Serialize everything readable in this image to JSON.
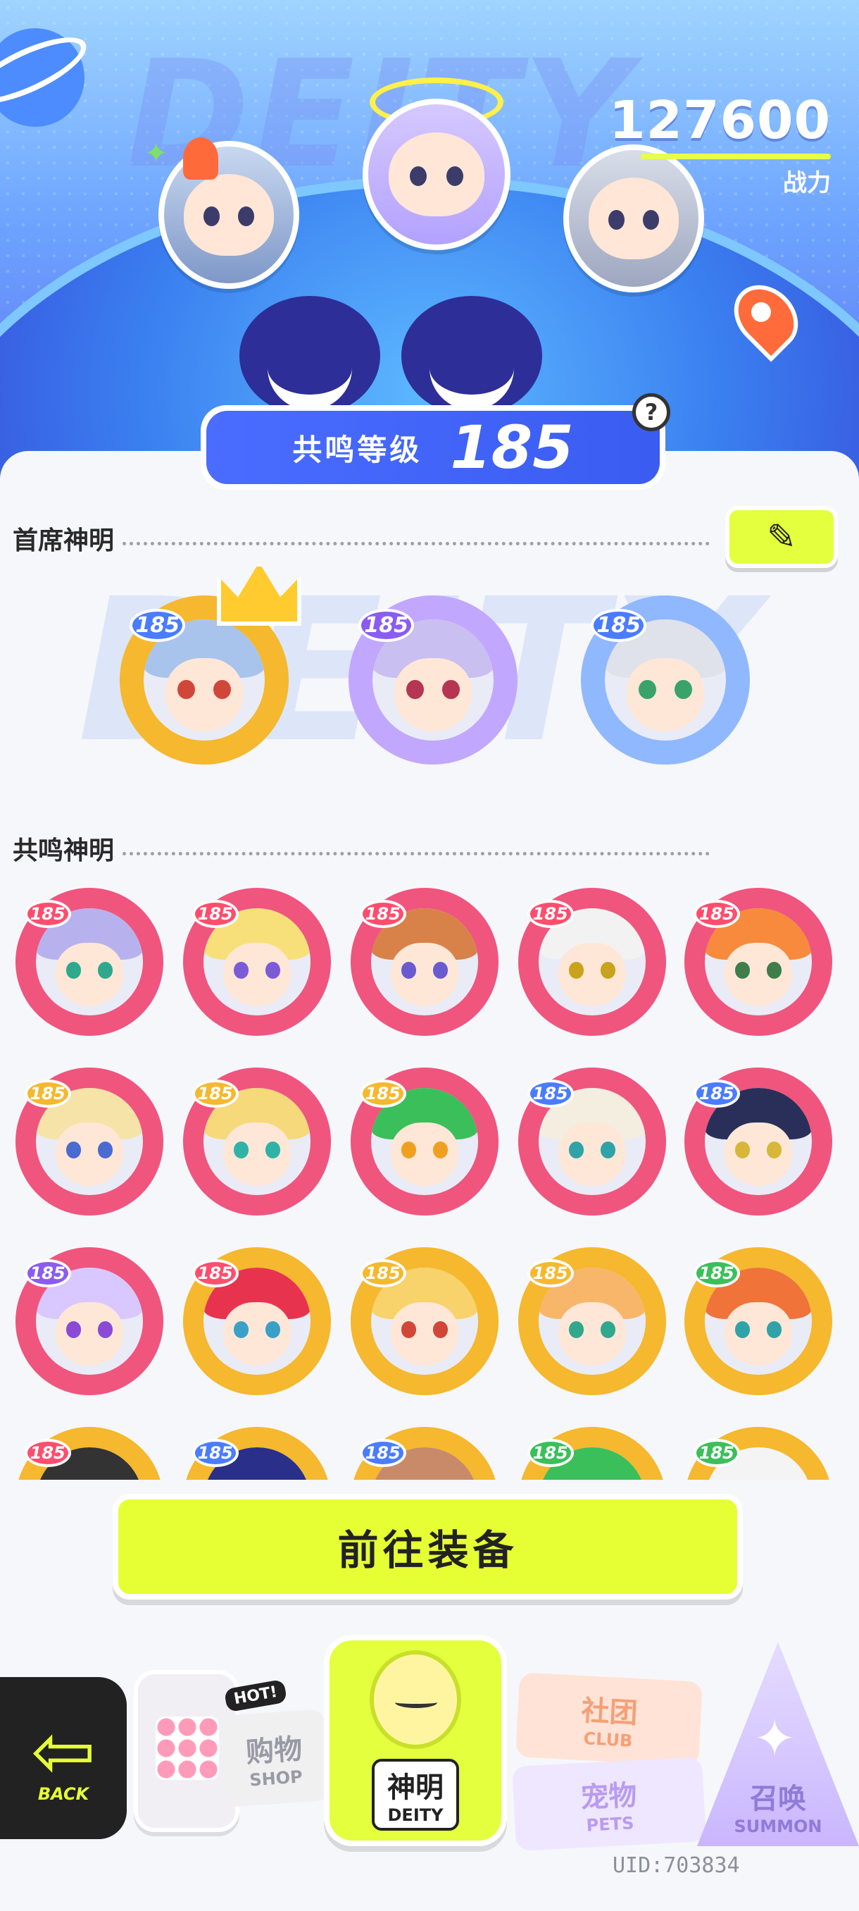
{
  "header": {
    "power_value": "127600",
    "power_label": "战力",
    "bg_word": "DEITY"
  },
  "resonance": {
    "label": "共鸣等级",
    "level": "185",
    "help": "?"
  },
  "sections": {
    "leader_title": "首席神明",
    "resonance_title": "共鸣神明",
    "bg_word": "DEITY"
  },
  "leaders": [
    {
      "level": "185",
      "ring": "#f5b82e",
      "hair": "#a9c4ec",
      "eye": "#d0473a",
      "badge": "#4a7cff",
      "crown": true
    },
    {
      "level": "185",
      "ring": "#c2a7ff",
      "hair": "#c9bff0",
      "eye": "#b53552",
      "badge": "#8a5cf0",
      "crown": false
    },
    {
      "level": "185",
      "ring": "#8fb8ff",
      "hair": "#dfe2ea",
      "eye": "#3aa36a",
      "badge": "#4a7cff",
      "crown": false
    }
  ],
  "members": [
    {
      "level": "185",
      "ring": "#f0557e",
      "hair": "#b7b2ee",
      "eye": "#2fa88e",
      "badge": "#ff4d6d"
    },
    {
      "level": "185",
      "ring": "#f0557e",
      "hair": "#f7e07a",
      "eye": "#7b5cd6",
      "badge": "#ff4d6d"
    },
    {
      "level": "185",
      "ring": "#f0557e",
      "hair": "#d8824a",
      "eye": "#6a5ad0",
      "badge": "#ff4d6d"
    },
    {
      "level": "185",
      "ring": "#f0557e",
      "hair": "#f2f2f2",
      "eye": "#c9a21e",
      "badge": "#ff4d6d"
    },
    {
      "level": "185",
      "ring": "#f0557e",
      "hair": "#f78a3c",
      "eye": "#3f7d4a",
      "badge": "#ff4d6d"
    },
    {
      "level": "185",
      "ring": "#f0557e",
      "hair": "#f6e3a8",
      "eye": "#4a6bd0",
      "badge": "#f5b82e"
    },
    {
      "level": "185",
      "ring": "#f0557e",
      "hair": "#f6d97a",
      "eye": "#2fb3a6",
      "badge": "#f5b82e"
    },
    {
      "level": "185",
      "ring": "#f0557e",
      "hair": "#3bbf5a",
      "eye": "#f0a020",
      "badge": "#f5b82e"
    },
    {
      "level": "185",
      "ring": "#f0557e",
      "hair": "#f3eee0",
      "eye": "#2fa3a8",
      "badge": "#4a7cff"
    },
    {
      "level": "185",
      "ring": "#f0557e",
      "hair": "#2a2f5a",
      "eye": "#d8b63a",
      "badge": "#4a7cff"
    },
    {
      "level": "185",
      "ring": "#f0557e",
      "hair": "#d9c8ff",
      "eye": "#8a4ad6",
      "badge": "#8a5cf0"
    },
    {
      "level": "185",
      "ring": "#f5b82e",
      "hair": "#e8334f",
      "eye": "#3aa0c8",
      "badge": "#ff4d6d"
    },
    {
      "level": "185",
      "ring": "#f5b82e",
      "hair": "#f8d26a",
      "eye": "#d0473a",
      "badge": "#f5b82e"
    },
    {
      "level": "185",
      "ring": "#f5b82e",
      "hair": "#f7b66a",
      "eye": "#2fa88e",
      "badge": "#f5b82e"
    },
    {
      "level": "185",
      "ring": "#f5b82e",
      "hair": "#f0733a",
      "eye": "#2fa3a8",
      "badge": "#3bbf5a"
    },
    {
      "level": "185",
      "ring": "#f5b82e",
      "hair": "#333333",
      "eye": "#333333",
      "badge": "#ff4d6d"
    },
    {
      "level": "185",
      "ring": "#f5b82e",
      "hair": "#2a2f8a",
      "eye": "#333333",
      "badge": "#4a7cff"
    },
    {
      "level": "185",
      "ring": "#f5b82e",
      "hair": "#c98a6a",
      "eye": "#333333",
      "badge": "#4a7cff"
    },
    {
      "level": "185",
      "ring": "#f5b82e",
      "hair": "#3bbf5a",
      "eye": "#333333",
      "badge": "#3bbf5a"
    },
    {
      "level": "185",
      "ring": "#f5b82e",
      "hair": "#f4f4f4",
      "eye": "#333333",
      "badge": "#3bbf5a"
    }
  ],
  "equip_button": "前往装备",
  "nav": {
    "back_en": "BACK",
    "shop_hot": "HOT!",
    "shop_cn": "购物",
    "shop_en": "SHOP",
    "deity_cn": "神明",
    "deity_en": "DEITY",
    "club_cn": "社团",
    "club_en": "CLUB",
    "pets_cn": "宠物",
    "pets_en": "PETS",
    "summon_cn": "召唤",
    "summon_en": "SUMMON"
  },
  "uid": "UID:703834",
  "colors": {
    "accent": "#e6ff35",
    "primary": "#4a6cff"
  },
  "icons": {
    "edit": "pencil-icon",
    "back": "arrow-left-icon",
    "location": "map-pin-icon",
    "help": "question-icon"
  }
}
